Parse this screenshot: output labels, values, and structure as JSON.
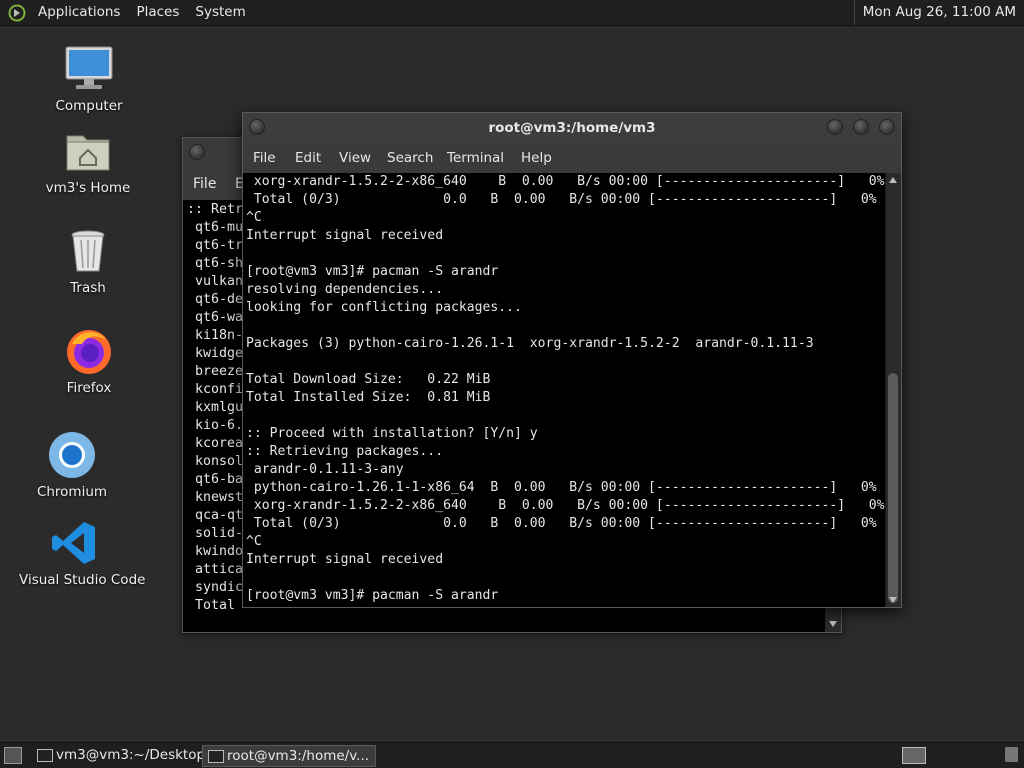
{
  "top_panel": {
    "menus": [
      "Applications",
      "Places",
      "System"
    ],
    "clock": "Mon Aug 26, 11:00 AM"
  },
  "desktop_icons": [
    {
      "label": "Computer",
      "icon": "computer-icon"
    },
    {
      "label": "vm3's Home",
      "icon": "home-folder-icon"
    },
    {
      "label": "Trash",
      "icon": "trash-icon"
    },
    {
      "label": "Firefox",
      "icon": "firefox-icon"
    },
    {
      "label": "Chromium",
      "icon": "chromium-icon"
    },
    {
      "label": "Visual Studio Code",
      "icon": "vscode-icon"
    }
  ],
  "back_window": {
    "menus": [
      "File",
      "E"
    ],
    "lines": [
      ":: Retr",
      " qt6-mu",
      " qt6-tr",
      " qt6-sh",
      " vulkan",
      " qt6-de",
      " qt6-wa",
      " ki18n-",
      " kwidge",
      " breeze",
      " kconfi",
      " kxmlgu",
      " kio-6.",
      " kcorea",
      " konsol",
      " qt6-ba",
      " knewst",
      " qca-qt",
      " solid-",
      " kwindo",
      " attica",
      " syndic",
      " Total "
    ]
  },
  "front_window": {
    "title": "root@vm3:/home/vm3",
    "menus": [
      "File",
      "Edit",
      "View",
      "Search",
      "Terminal",
      "Help"
    ],
    "lines": [
      " xorg-xrandr-1.5.2-2-x86_640    B  0.00   B/s 00:00 [----------------------]   0%",
      " Total (0/3)             0.0   B  0.00   B/s 00:00 [----------------------]   0%",
      "^C",
      "Interrupt signal received",
      "",
      "[root@vm3 vm3]# pacman -S arandr",
      "resolving dependencies...",
      "looking for conflicting packages...",
      "",
      "Packages (3) python-cairo-1.26.1-1  xorg-xrandr-1.5.2-2  arandr-0.1.11-3",
      "",
      "Total Download Size:   0.22 MiB",
      "Total Installed Size:  0.81 MiB",
      "",
      ":: Proceed with installation? [Y/n] y",
      ":: Retrieving packages...",
      " arandr-0.1.11-3-any",
      " python-cairo-1.26.1-1-x86_64  B  0.00   B/s 00:00 [----------------------]   0%",
      " xorg-xrandr-1.5.2-2-x86_640    B  0.00   B/s 00:00 [----------------------]   0%",
      " Total (0/3)             0.0   B  0.00   B/s 00:00 [----------------------]   0%",
      "^C",
      "Interrupt signal received",
      "",
      "[root@vm3 vm3]# pacman -S arandr"
    ]
  },
  "taskbar": {
    "items": [
      {
        "label": "vm3@vm3:~/Desktop",
        "active": false
      },
      {
        "label": "root@vm3:/home/v...",
        "active": true
      }
    ]
  }
}
